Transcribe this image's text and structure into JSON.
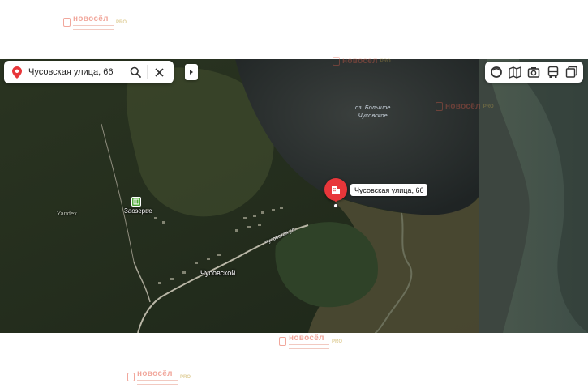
{
  "watermarks": [
    {
      "text": "новосёл",
      "badge": "PRO"
    },
    {
      "text": "новосёл",
      "badge": "PRO"
    },
    {
      "text": "новосёл",
      "badge": "PRO"
    },
    {
      "text": "новосёл",
      "badge": "PRO"
    },
    {
      "text": "новосёл",
      "badge": "PRO"
    }
  ],
  "search": {
    "value": "Чусовская улица, 66",
    "search_icon": "search-icon",
    "clear_icon": "close-icon"
  },
  "toolbar": {
    "buttons": [
      "layers-icon",
      "map-book-icon",
      "camera-icon",
      "bus-icon",
      "layers-stack-icon"
    ]
  },
  "map": {
    "marker_label": "Чусовская улица, 66",
    "lake_label_line1": "оз. Большое",
    "lake_label_line2": "Чусовское",
    "village_label": "Заозерье",
    "town_label": "Чусовской",
    "watermark_label": "Yandex",
    "street_label": "Чусовская ул."
  },
  "colors": {
    "marker": "#e8363a",
    "brand_watermark": "#e7604c"
  }
}
